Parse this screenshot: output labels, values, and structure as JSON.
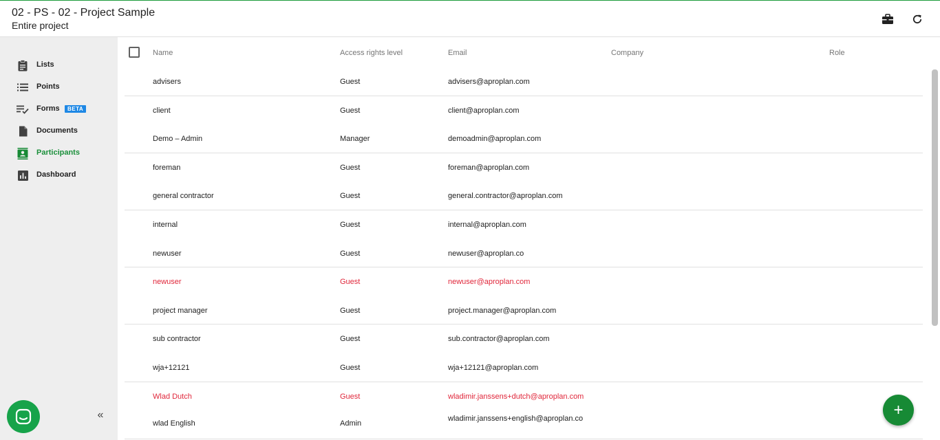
{
  "header": {
    "title": "02 - PS - 02 - Project Sample",
    "subtitle": "Entire project",
    "actions": [
      {
        "name": "briefcase-icon"
      },
      {
        "name": "refresh-icon"
      }
    ]
  },
  "sidebar": {
    "items": [
      {
        "label": "Lists",
        "icon": "clipboard-icon",
        "active": false
      },
      {
        "label": "Points",
        "icon": "list-icon",
        "active": false
      },
      {
        "label": "Forms",
        "icon": "checklist-icon",
        "active": false,
        "badge": "BETA"
      },
      {
        "label": "Documents",
        "icon": "document-icon",
        "active": false
      },
      {
        "label": "Participants",
        "icon": "contact-icon",
        "active": true
      },
      {
        "label": "Dashboard",
        "icon": "bar-chart-icon",
        "active": false
      }
    ],
    "collapse_label": "«"
  },
  "table": {
    "columns": {
      "name": "Name",
      "access": "Access rights level",
      "email": "Email",
      "company": "Company",
      "role": "Role"
    },
    "rows": [
      {
        "name": "advisers",
        "access": "Guest",
        "email": "advisers@aproplan.com",
        "error": false
      },
      {
        "name": "client",
        "access": "Guest",
        "email": "client@aproplan.com",
        "error": false
      },
      {
        "name": "Demo – Admin",
        "access": "Manager",
        "email": "demoadmin@aproplan.com",
        "error": false
      },
      {
        "name": "foreman",
        "access": "Guest",
        "email": "foreman@aproplan.com",
        "error": false
      },
      {
        "name": "general contractor",
        "access": "Guest",
        "email": "general.contractor@aproplan.com",
        "error": false
      },
      {
        "name": "internal",
        "access": "Guest",
        "email": "internal@aproplan.com",
        "error": false
      },
      {
        "name": "newuser",
        "access": "Guest",
        "email": "newuser@aproplan.co",
        "error": false
      },
      {
        "name": "newuser",
        "access": "Guest",
        "email": "newuser@aproplan.com",
        "error": true
      },
      {
        "name": "project manager",
        "access": "Guest",
        "email": "project.manager@aproplan.com",
        "error": false
      },
      {
        "name": "sub contractor",
        "access": "Guest",
        "email": "sub.contractor@aproplan.com",
        "error": false
      },
      {
        "name": "wja+12121",
        "access": "Guest",
        "email": "wja+12121@aproplan.com",
        "error": false
      },
      {
        "name": "Wlad Dutch",
        "access": "Guest",
        "email": "wladimir.janssens+dutch@aproplan.com",
        "error": true
      },
      {
        "name": "wlad English",
        "access": "Admin",
        "email": "wladimir.janssens+english@aproplan.co",
        "error": false
      }
    ]
  },
  "fab": {
    "label": "+"
  },
  "colors": {
    "accent": "#178a35",
    "error": "#e0263a",
    "badge": "#1e88e5"
  }
}
